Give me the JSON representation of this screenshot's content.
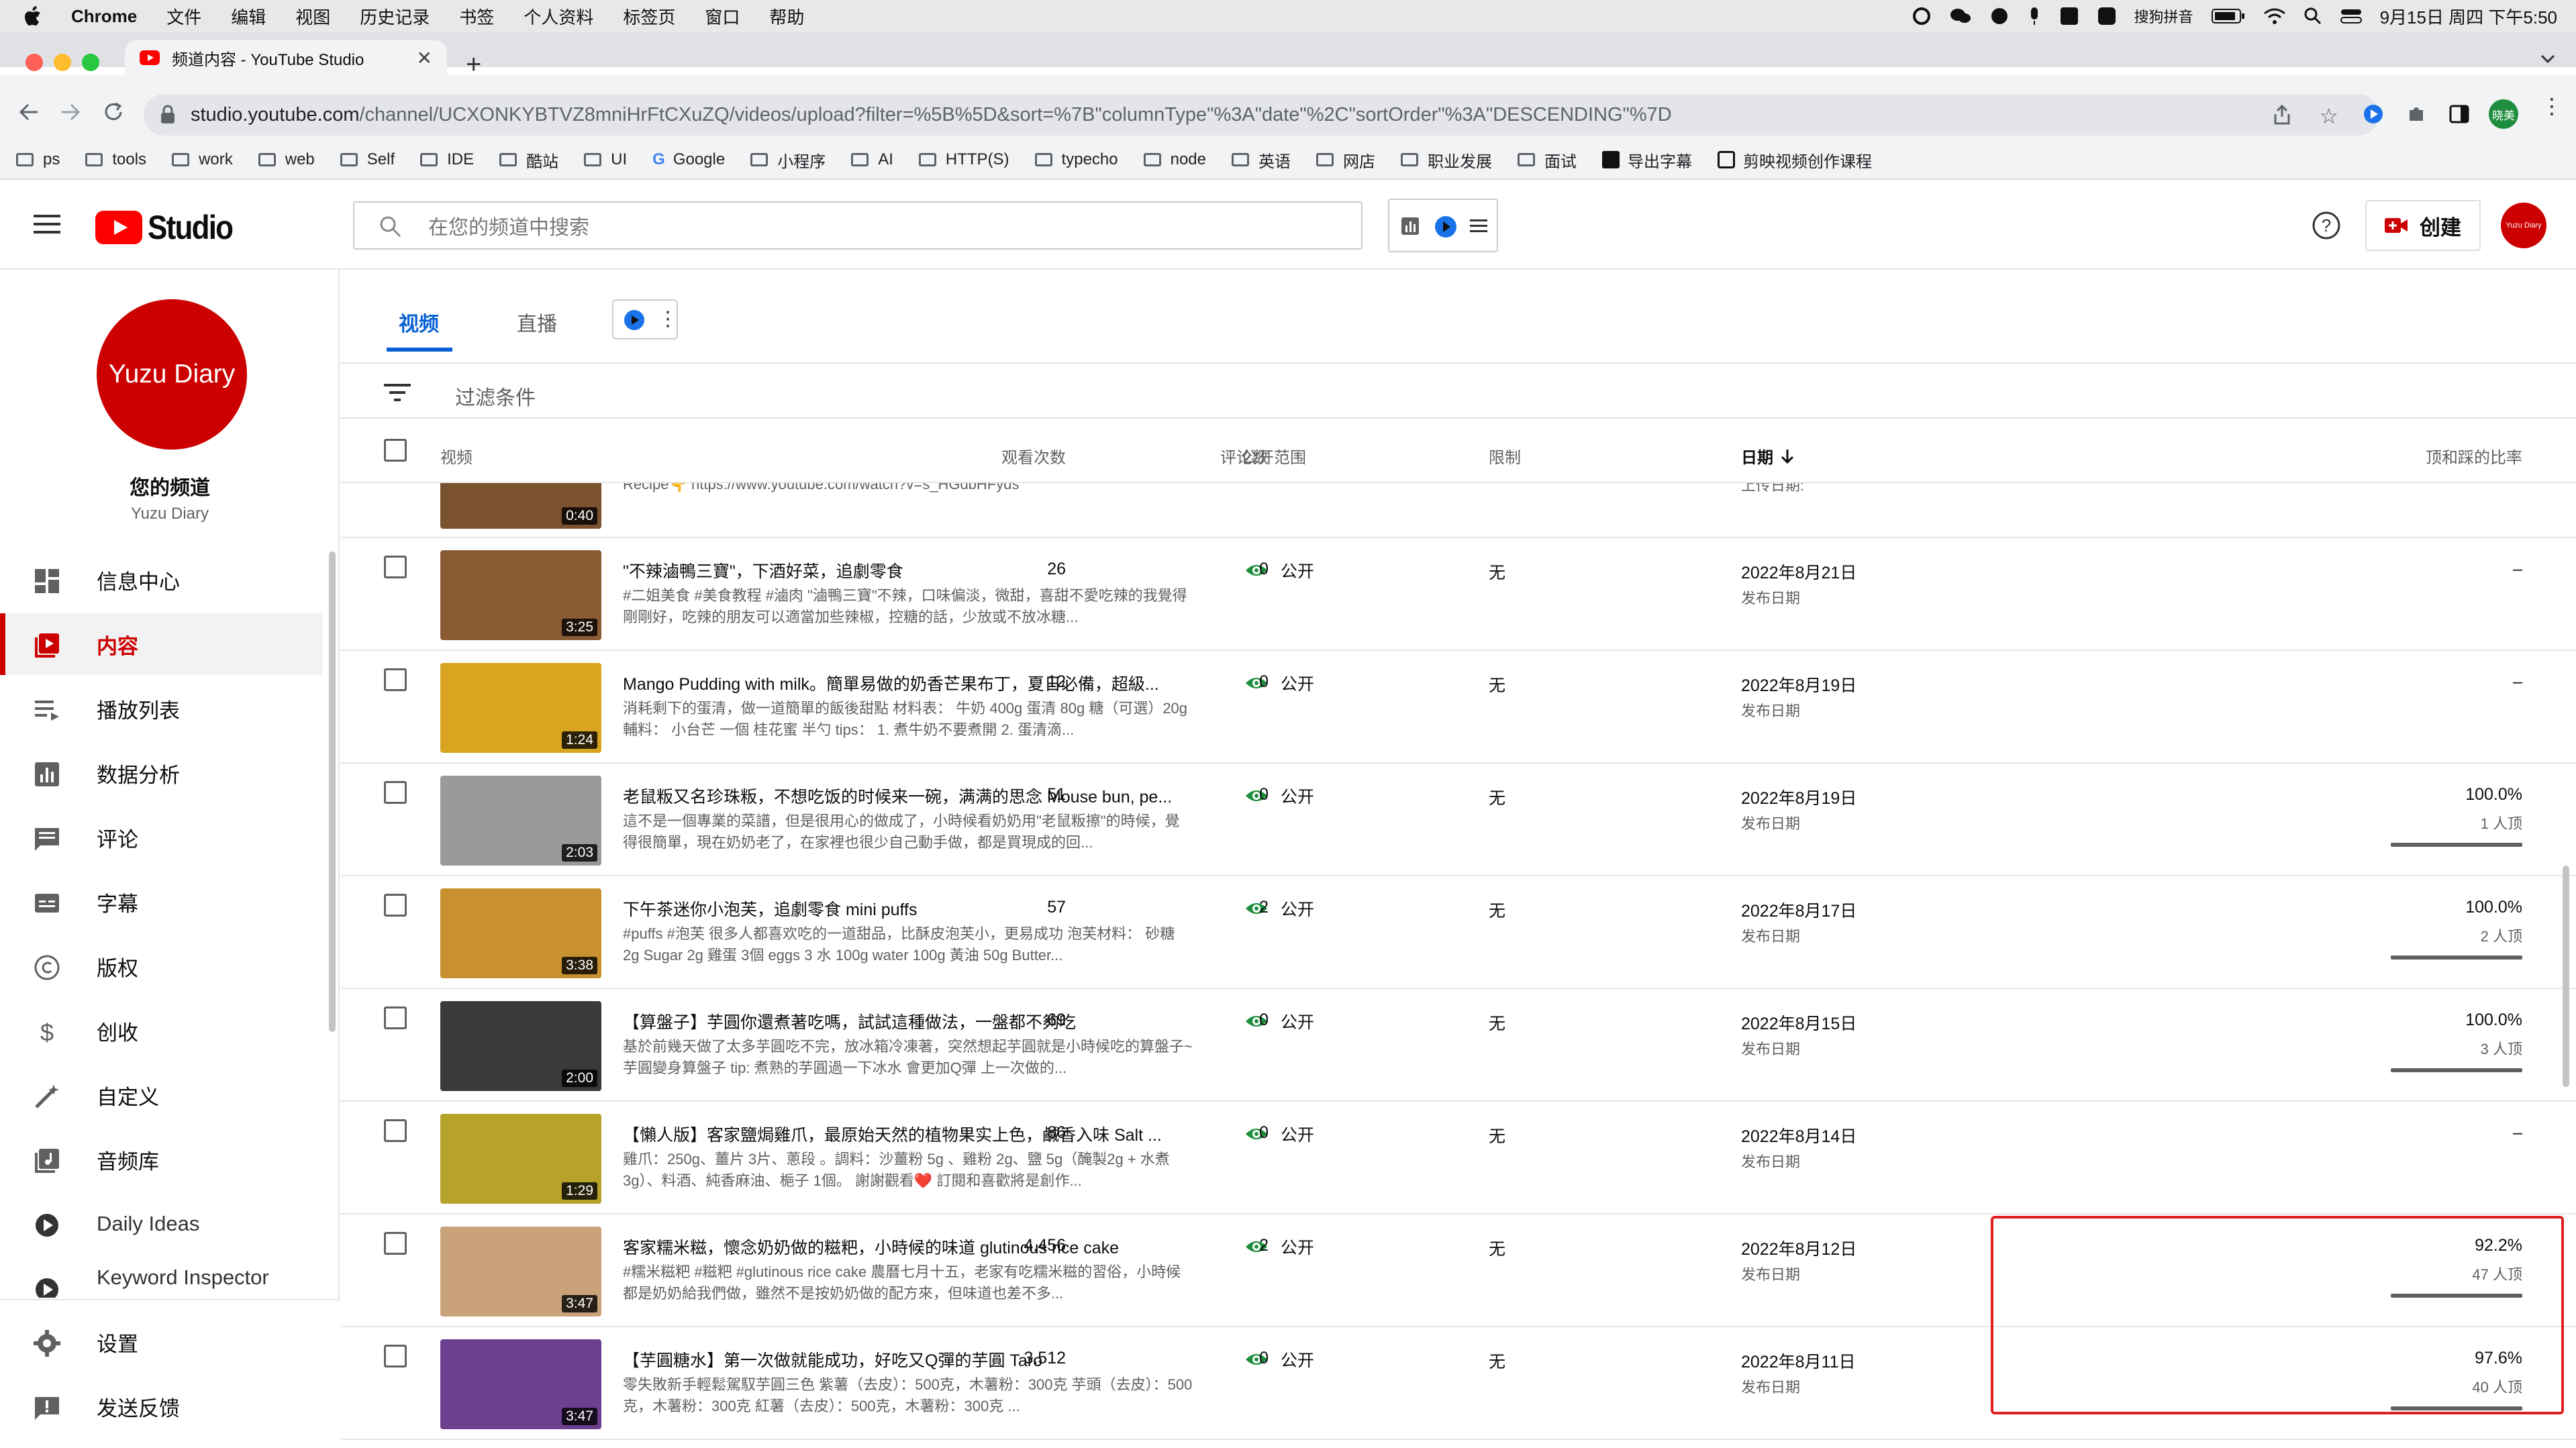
{
  "menubar": {
    "app": "Chrome",
    "items": [
      "文件",
      "编辑",
      "视图",
      "历史记录",
      "书签",
      "个人资料",
      "标签页",
      "窗口",
      "帮助"
    ],
    "ime": "搜狗拼音",
    "clock": "9月15日 周四 下午5:50"
  },
  "browser": {
    "tab_title": "频道内容 - YouTube Studio",
    "url_host": "studio.youtube.com",
    "url_path": "/channel/UCXONKYBTVZ8mniHrFtCXuZQ/videos/upload?filter=%5B%5D&sort=%7B\"columnType\"%3A\"date\"%2C\"sortOrder\"%3A\"DESCENDING\"%7D",
    "profile_name": "晓美",
    "bookmarks": [
      "ps",
      "tools",
      "work",
      "web",
      "Self",
      "IDE",
      "酷站",
      "UI",
      "Google",
      "小程序",
      "AI",
      "HTTP(S)",
      "typecho",
      "node",
      "英语",
      "网店",
      "职业发展",
      "面试",
      "导出字幕",
      "剪映视频创作课程"
    ]
  },
  "header": {
    "logo_text": "Studio",
    "search_placeholder": "在您的频道中搜索",
    "create_label": "创建",
    "avatar_text": "Yuzu Diary"
  },
  "sidebar": {
    "channel_avatar_text": "Yuzu Diary",
    "channel_title": "您的频道",
    "channel_name": "Yuzu Diary",
    "items": [
      {
        "label": "信息中心",
        "icon": "dashboard-icon"
      },
      {
        "label": "内容",
        "icon": "content-icon"
      },
      {
        "label": "播放列表",
        "icon": "playlist-icon"
      },
      {
        "label": "数据分析",
        "icon": "analytics-icon"
      },
      {
        "label": "评论",
        "icon": "comments-icon"
      },
      {
        "label": "字幕",
        "icon": "subtitles-icon"
      },
      {
        "label": "版权",
        "icon": "copyright-icon"
      },
      {
        "label": "创收",
        "icon": "monetization-icon"
      },
      {
        "label": "自定义",
        "icon": "customization-icon"
      },
      {
        "label": "音频库",
        "icon": "audio-library-icon"
      },
      {
        "label": "Daily Ideas",
        "icon": "daily-ideas-icon"
      },
      {
        "label": "Keyword Inspector",
        "icon": "keyword-inspector-icon"
      }
    ],
    "settings_label": "设置",
    "feedback_label": "发送反馈"
  },
  "content": {
    "tabs": [
      "视频",
      "直播"
    ],
    "filter_placeholder": "过滤条件",
    "columns": {
      "video": "视频",
      "visibility": "公开范围",
      "restrictions": "限制",
      "date": "日期",
      "views": "观看次数",
      "comments": "评论数",
      "likes_ratio": "顶和踩的比率"
    },
    "partial_row": {
      "desc": "Recipe👇 https://www.youtube.com/watch?v=s_HGdbHFyds",
      "duration": "0:40",
      "date_sub": "上传日期:"
    },
    "rows": [
      {
        "title": "\"不辣滷鴨三寶\"，下酒好菜，追劇零食",
        "desc": "#二姐美食 #美食教程 #滷肉 \"滷鴨三寶\"不辣，口味偏淡，微甜，喜甜不愛吃辣的我覺得剛剛好，吃辣的朋友可以適當加些辣椒，控糖的話，少放或不放冰糖...",
        "duration": "3:25",
        "visibility": "公开",
        "restrictions": "无",
        "date": "2022年8月21日",
        "date_sub": "发布日期",
        "views": "26",
        "comments": "0",
        "ratio": "–",
        "ratio_sub": "",
        "thumb": "#8a5a33"
      },
      {
        "title": "Mango Pudding with milk。簡單易做的奶香芒果布丁，夏日必備，超級...",
        "desc": "消耗剩下的蛋清，做一道簡單的飯後甜點 材料表： 牛奶 400g 蛋清 80g 糖（可選）20g 輔料： 小台芒 一個 桂花蜜 半勺 tips： 1. 煮牛奶不要煮開 2. 蛋清滴...",
        "duration": "1:24",
        "visibility": "公开",
        "restrictions": "无",
        "date": "2022年8月19日",
        "date_sub": "发布日期",
        "views": "12",
        "comments": "0",
        "ratio": "–",
        "ratio_sub": "",
        "thumb": "#d9a521"
      },
      {
        "title": "老鼠粄又名珍珠粄，不想吃饭的时候来一碗，满满的思念 Mouse bun, pe...",
        "desc": "這不是一個專業的菜譜，但是很用心的做成了，小時候看奶奶用\"老鼠粄擦\"的時候，覺得很簡單，現在奶奶老了，在家裡也很少自己動手做，都是買現成的回...",
        "duration": "2:03",
        "visibility": "公开",
        "restrictions": "无",
        "date": "2022年8月19日",
        "date_sub": "发布日期",
        "views": "51",
        "comments": "0",
        "ratio": "100.0%",
        "ratio_sub": "1 人顶",
        "thumb": "#9a9a9a"
      },
      {
        "title": "下午茶迷你小泡芙，追劇零食 mini puffs",
        "desc": "#puffs #泡芙 很多人都喜欢吃的一道甜品，比酥皮泡芙小，更易成功 泡芙材料： 砂糖 2g Sugar 2g 雞蛋 3個 eggs 3 水 100g water 100g 黃油 50g Butter...",
        "duration": "3:38",
        "visibility": "公开",
        "restrictions": "无",
        "date": "2022年8月17日",
        "date_sub": "发布日期",
        "views": "57",
        "comments": "2",
        "ratio": "100.0%",
        "ratio_sub": "2 人顶",
        "thumb": "#c8902f"
      },
      {
        "title": "【算盤子】芋圓你還煮著吃嗎，試試這種做法，一盤都不夠吃",
        "desc": "基於前幾天做了太多芋圓吃不完，放冰箱冷凍著，突然想起芋圓就是小時候吃的算盤子~ 芋圓變身算盤子 tip: 煮熟的芋圓過一下冰水 會更加Q彈 上一次做的...",
        "duration": "2:00",
        "visibility": "公开",
        "restrictions": "无",
        "date": "2022年8月15日",
        "date_sub": "发布日期",
        "views": "69",
        "comments": "0",
        "ratio": "100.0%",
        "ratio_sub": "3 人顶",
        "thumb": "#3a3a3a"
      },
      {
        "title": "【懶人版】客家鹽焗雞爪，最原始天然的植物果实上色，鹹香入味 Salt ...",
        "desc": "雞爪：250g、薑片 3片、蔥段 。調料：沙薑粉 5g 、雞粉 2g、鹽 5g（醃製2g + 水煮3g）、料酒、純香麻油、梔子 1個。 謝謝觀看❤️ 訂閱和喜歡將是創作...",
        "duration": "1:29",
        "visibility": "公开",
        "restrictions": "无",
        "date": "2022年8月14日",
        "date_sub": "发布日期",
        "views": "86",
        "comments": "0",
        "ratio": "–",
        "ratio_sub": "",
        "thumb": "#b7a22a"
      },
      {
        "title": "客家糯米糍，懷念奶奶做的糍粑，小時候的味道 glutinous rice cake",
        "desc": "#糯米糍粑 #糍粑 #glutinous rice cake 農曆七月十五，老家有吃糯米糍的習俗，小時候都是奶奶給我們做，雖然不是按奶奶做的配方來，但味道也差不多...",
        "duration": "3:47",
        "visibility": "公开",
        "restrictions": "无",
        "date": "2022年8月12日",
        "date_sub": "发布日期",
        "views": "4,456",
        "comments": "2",
        "ratio": "92.2%",
        "ratio_sub": "47 人顶",
        "thumb": "#c9a27a"
      },
      {
        "title": "【芋圓糖水】第一次做就能成功，好吃又Q彈的芋圓 Taro",
        "desc": "零失敗新手輕鬆駕馭芋圓三色 紫薯（去皮）：500克，木薯粉：300克 芋頭（去皮）：500克，木薯粉：300克 紅薯（去皮）：500克，木薯粉：300克 ...",
        "duration": "3:47",
        "visibility": "公开",
        "restrictions": "无",
        "date": "2022年8月11日",
        "date_sub": "发布日期",
        "views": "3,512",
        "comments": "0",
        "ratio": "97.6%",
        "ratio_sub": "40 人顶",
        "thumb": "#6d3f8f"
      }
    ]
  },
  "colors": {
    "brand_red": "#cc0000",
    "link_blue": "#065fd4",
    "public_green": "#1e8e3e",
    "highlight_red": "#e02020"
  }
}
